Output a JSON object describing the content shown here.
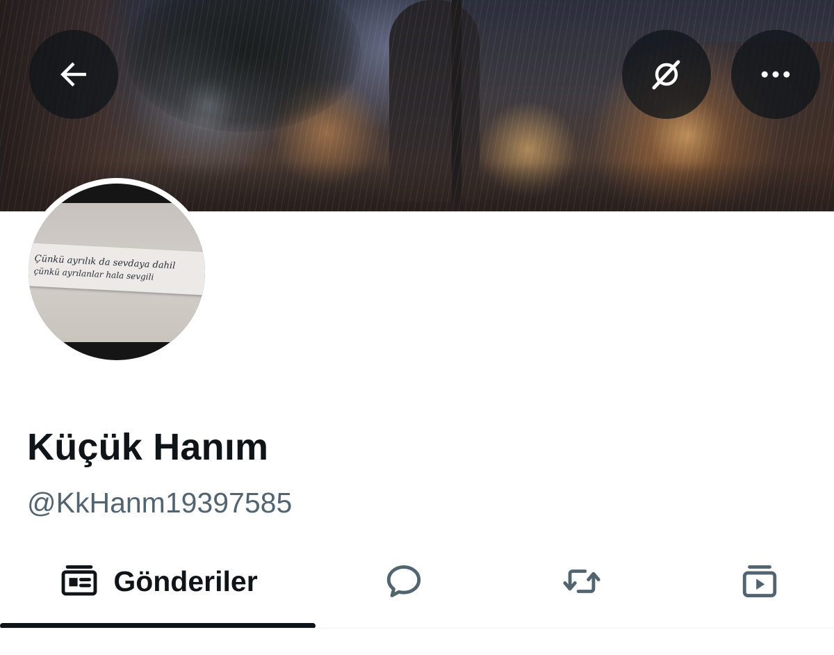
{
  "header": {
    "back_icon": "arrow-left-icon",
    "grok_icon": "grok-icon",
    "more_icon": "more-horizontal-icon"
  },
  "banner": {
    "description_colors": [
      "#2b2f3c",
      "#4a3a32",
      "#e68c3c"
    ]
  },
  "avatar": {
    "note_text_line1": "Çünkü ayrılık da sevdaya dahil",
    "note_text_line2": "çünkü ayrılanlar hala sevgili"
  },
  "profile": {
    "display_name": "Küçük Hanım",
    "handle": "@KkHanm19397585"
  },
  "tabs": [
    {
      "label": "Gönderiler",
      "icon": "posts-icon",
      "selected": true
    },
    {
      "label": "",
      "icon": "replies-icon",
      "selected": false
    },
    {
      "label": "",
      "icon": "reposts-icon",
      "selected": false
    },
    {
      "label": "",
      "icon": "media-icon",
      "selected": false
    }
  ],
  "colors": {
    "text_primary": "#0f1419",
    "text_secondary": "#536471",
    "divider": "#eff3f4"
  }
}
